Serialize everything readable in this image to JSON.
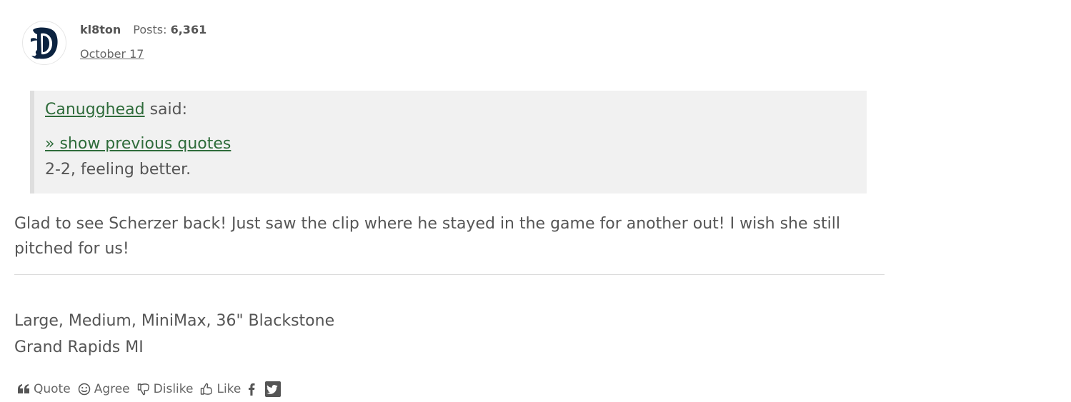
{
  "author": {
    "name": "kl8ton",
    "posts_label": "Posts:",
    "posts_count": "6,361",
    "date": "October 17",
    "avatar_icon": "detroit-tigers-d-logo"
  },
  "quote": {
    "user": "Canugghead",
    "said": " said:",
    "show_previous": "» show previous quotes",
    "text": "2-2, feeling better."
  },
  "body": {
    "text": "Glad to see Scherzer back!  Just saw the clip where he stayed in the game for another out! I wish she still pitched for us!"
  },
  "signature": {
    "line1": "Large, Medium, MiniMax, 36\" Blackstone",
    "line2": "Grand Rapids MI"
  },
  "actions": {
    "quote": "Quote",
    "agree": "Agree",
    "dislike": "Dislike",
    "like": "Like",
    "share_icons": [
      "facebook-icon",
      "twitter-icon"
    ]
  },
  "colors": {
    "link": "#2e6b3a",
    "text": "#555555",
    "quote_bg": "#f1f1f1",
    "logo": "#0c2340"
  }
}
